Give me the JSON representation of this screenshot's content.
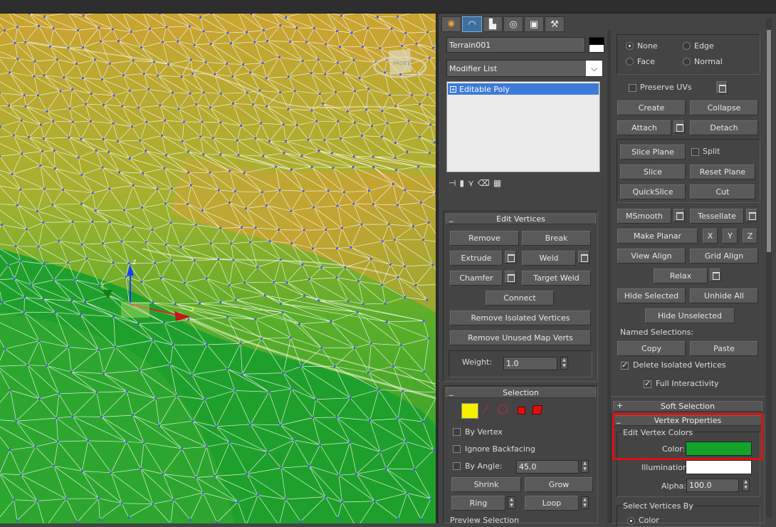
{
  "window": {
    "title": ""
  },
  "viewport": {
    "nav_cube_label": "FRONT",
    "axis_x": "X",
    "axis_y": "Y",
    "axis_z": "Z"
  },
  "tabs": [
    {
      "name": "create-tab",
      "glyph": "✺"
    },
    {
      "name": "modify-tab",
      "glyph": "◠"
    },
    {
      "name": "hierarchy-tab",
      "glyph": "▙"
    },
    {
      "name": "motion-tab",
      "glyph": "◎"
    },
    {
      "name": "display-tab",
      "glyph": "▣"
    },
    {
      "name": "utilities-tab",
      "glyph": "⚒"
    }
  ],
  "object": {
    "name": "Terrain001",
    "color_hex": "#000000"
  },
  "modifier_list": {
    "label": "Modifier List",
    "items": [
      {
        "label": "Editable Poly"
      }
    ]
  },
  "edit_vertices": {
    "title": "Edit Vertices",
    "remove": "Remove",
    "break": "Break",
    "extrude": "Extrude",
    "weld": "Weld",
    "chamfer": "Chamfer",
    "target_weld": "Target Weld",
    "connect": "Connect",
    "remove_isolated": "Remove Isolated Vertices",
    "remove_unused": "Remove Unused Map Verts",
    "weight_label": "Weight:",
    "weight_value": "1.0"
  },
  "selection": {
    "title": "Selection",
    "by_vertex": "By Vertex",
    "ignore_backfacing": "Ignore Backfacing",
    "by_angle": "By Angle:",
    "angle_value": "45.0",
    "shrink": "Shrink",
    "grow": "Grow",
    "ring": "Ring",
    "loop": "Loop",
    "preview_selection": "Preview Selection"
  },
  "constraints": {
    "none": "None",
    "edge": "Edge",
    "face": "Face",
    "normal": "Normal",
    "preserve_uvs": "Preserve UVs"
  },
  "edit_geometry": {
    "create": "Create",
    "collapse": "Collapse",
    "attach": "Attach",
    "detach": "Detach",
    "slice_plane": "Slice Plane",
    "split": "Split",
    "slice": "Slice",
    "reset_plane": "Reset Plane",
    "quickslice": "QuickSlice",
    "cut": "Cut",
    "msmooth": "MSmooth",
    "tessellate": "Tessellate",
    "make_planar": "Make Planar",
    "x": "X",
    "y": "Y",
    "z": "Z",
    "view_align": "View Align",
    "grid_align": "Grid Align",
    "relax": "Relax",
    "hide_selected": "Hide Selected",
    "unhide_all": "Unhide All",
    "hide_unselected": "Hide Unselected",
    "named_selections": "Named Selections:",
    "copy": "Copy",
    "paste": "Paste",
    "delete_isolated": "Delete Isolated Vertices",
    "full_interactivity": "Full Interactivity"
  },
  "soft_selection": {
    "title": "Soft Selection"
  },
  "vertex_properties": {
    "title": "Vertex Properties",
    "edit_vertex_colors": "Edit Vertex Colors",
    "color_label": "Color:",
    "color_hex": "#13a22a",
    "illumination_label": "Illumination:",
    "illumination_hex": "#ffffff",
    "alpha_label": "Alpha:",
    "alpha_value": "100.0",
    "select_vertices_by": "Select Vertices By",
    "select_by_color": "Color"
  },
  "colors": {
    "highlight": "#e01010",
    "active_tab": "#3f6fa0",
    "list_selected": "#3e7ad8"
  }
}
